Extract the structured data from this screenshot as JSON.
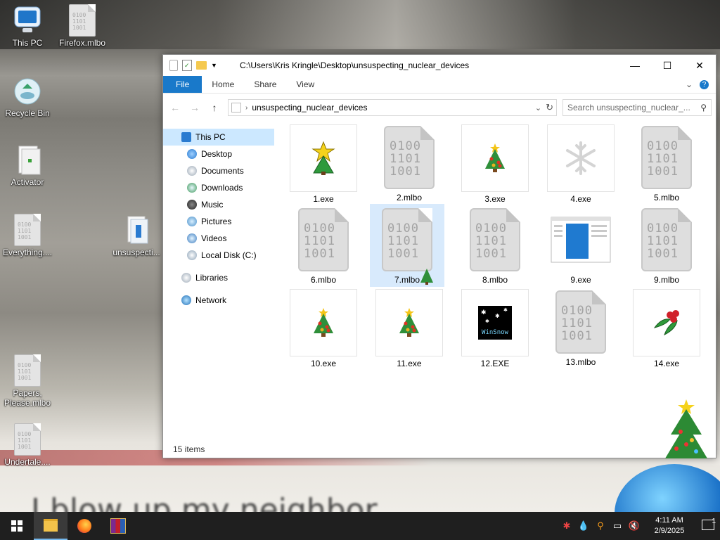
{
  "desktop": {
    "icons": [
      {
        "label": "This PC"
      },
      {
        "label": "Firefox.mlbo"
      },
      {
        "label": "Recycle Bin"
      },
      {
        "label": "Activator"
      },
      {
        "label": "Everything...."
      },
      {
        "label": "unsuspecti..."
      },
      {
        "label": "Papers, Please.mlbo"
      },
      {
        "label": "Undertale...."
      }
    ],
    "wallpaper_text": "I blow up my neighbor"
  },
  "window": {
    "path": "C:\\Users\\Kris Kringle\\Desktop\\unsuspecting_nuclear_devices",
    "ribbon": {
      "file": "File",
      "home": "Home",
      "share": "Share",
      "view": "View"
    },
    "address": "unsuspecting_nuclear_devices",
    "search_placeholder": "Search unsuspecting_nuclear_...",
    "nav": {
      "this_pc": "This PC",
      "desktop": "Desktop",
      "documents": "Documents",
      "downloads": "Downloads",
      "music": "Music",
      "pictures": "Pictures",
      "videos": "Videos",
      "local_disk": "Local Disk (C:)",
      "libraries": "Libraries",
      "network": "Network"
    },
    "files": [
      {
        "name": "1.exe",
        "icon": "star-tree-icon"
      },
      {
        "name": "2.mlbo",
        "icon": "binary-file-icon"
      },
      {
        "name": "3.exe",
        "icon": "christmas-tree-icon"
      },
      {
        "name": "4.exe",
        "icon": "snowflake-icon"
      },
      {
        "name": "5.mlbo",
        "icon": "binary-file-icon"
      },
      {
        "name": "6.mlbo",
        "icon": "binary-file-icon"
      },
      {
        "name": "7.mlbo",
        "icon": "binary-file-icon"
      },
      {
        "name": "8.mlbo",
        "icon": "binary-file-icon"
      },
      {
        "name": "9.exe",
        "icon": "window-app-icon"
      },
      {
        "name": "9.mlbo",
        "icon": "binary-file-icon"
      },
      {
        "name": "10.exe",
        "icon": "christmas-tree-icon"
      },
      {
        "name": "11.exe",
        "icon": "christmas-tree-icon"
      },
      {
        "name": "12.EXE",
        "icon": "winsnow-icon"
      },
      {
        "name": "13.mlbo",
        "icon": "binary-file-icon"
      },
      {
        "name": "14.exe",
        "icon": "holly-icon"
      }
    ],
    "winsnow_label": "WinSnow",
    "binary_text": [
      "0100",
      "1101",
      "1001"
    ],
    "status": "15 items"
  },
  "taskbar": {
    "clock_time": "4:11 AM",
    "clock_date": "2/9/2025",
    "notification_count": "1"
  },
  "colors": {
    "accent": "#1979ca",
    "selection": "#cce8ff",
    "taskbar": "#1f1f1f"
  }
}
